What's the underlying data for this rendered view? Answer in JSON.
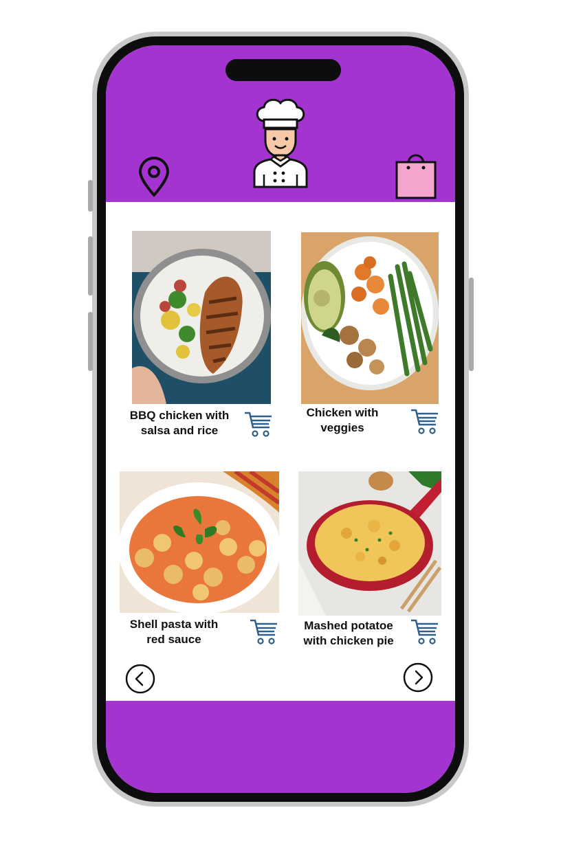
{
  "header": {
    "location_icon": "map-pin-icon",
    "avatar_icon": "chef-avatar-icon",
    "bag_icon": "shopping-bag-icon"
  },
  "menu": {
    "items": [
      {
        "title_line1": "BBQ chicken with",
        "title_line2": "salsa and rice",
        "cart_icon": "cart-icon"
      },
      {
        "title_line1": "Chicken with",
        "title_line2": "veggies",
        "cart_icon": "cart-icon"
      },
      {
        "title_line1": "Shell pasta with",
        "title_line2": "red sauce",
        "cart_icon": "cart-icon"
      },
      {
        "title_line1": "Mashed potatoe",
        "title_line2": "with chicken pie",
        "cart_icon": "cart-icon"
      }
    ]
  },
  "pagination": {
    "prev_icon": "chevron-left-icon",
    "next_icon": "chevron-right-icon"
  },
  "colors": {
    "header": "#a334d0",
    "footer": "#a334d0",
    "bag": "#f4a6cf",
    "cart": "#2e5f8a"
  }
}
